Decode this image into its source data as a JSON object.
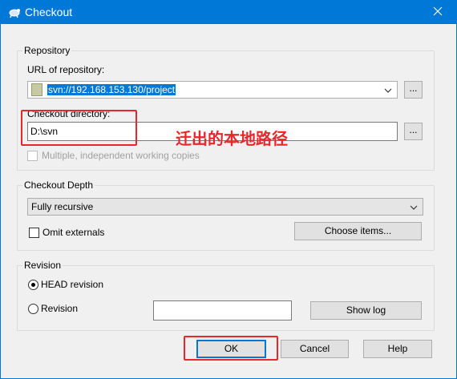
{
  "window": {
    "title": "Checkout",
    "icon": "tortoise-svn-icon",
    "close_icon": "close-icon"
  },
  "repository": {
    "group_label": "Repository",
    "url_label": "URL of repository:",
    "url_value": "svn://192.168.153.130/project",
    "url_browse": "...",
    "dir_label": "Checkout directory:",
    "dir_value": "D:\\svn",
    "dir_browse": "...",
    "multiple_label": "Multiple, independent working copies",
    "multiple_checked": false
  },
  "annotation": {
    "text": "迁出的本地路径",
    "color": "#e8272c"
  },
  "depth": {
    "group_label": "Checkout Depth",
    "selected": "Fully recursive",
    "omit_label": "Omit externals",
    "omit_checked": false,
    "choose_items": "Choose items..."
  },
  "revision": {
    "group_label": "Revision",
    "head_label": "HEAD revision",
    "head_selected": true,
    "revision_label": "Revision",
    "revision_value": "",
    "show_log": "Show log"
  },
  "buttons": {
    "ok": "OK",
    "cancel": "Cancel",
    "help": "Help"
  },
  "colors": {
    "titlebar": "#0078d7",
    "highlight": "#e8272c"
  }
}
